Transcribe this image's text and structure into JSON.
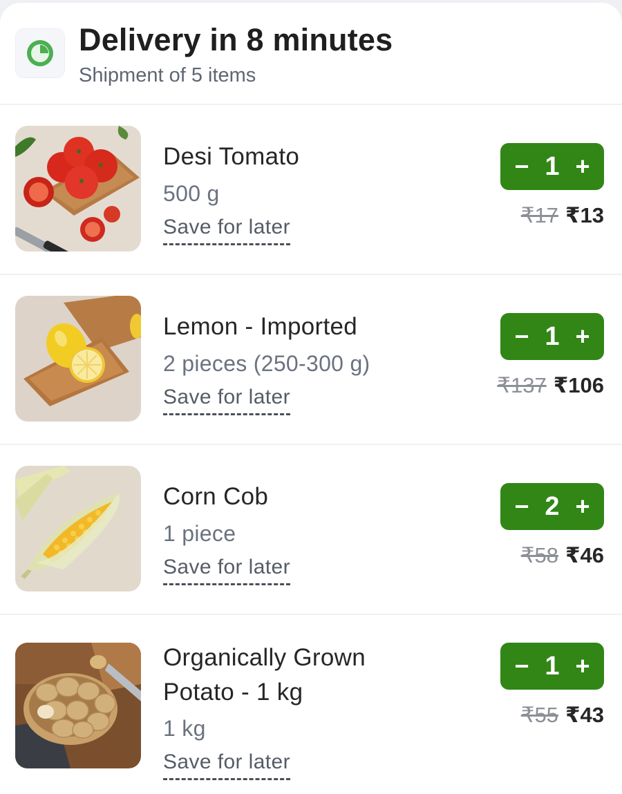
{
  "header": {
    "title": "Delivery in 8 minutes",
    "subtitle": "Shipment of 5 items",
    "icon": "clock-icon"
  },
  "colors": {
    "accent_green": "#318616",
    "icon_green": "#4caf50"
  },
  "items": [
    {
      "name_line1": "Desi Tomato",
      "name_line2": "",
      "quantity_text": "500 g",
      "save_label": "Save for later",
      "count": "1",
      "decrement": "−",
      "increment": "+",
      "mrp": "₹17",
      "price": "₹13",
      "image": "tomato-image"
    },
    {
      "name_line1": "Lemon - Imported",
      "name_line2": "",
      "quantity_text": "2 pieces (250-300 g)",
      "save_label": "Save for later",
      "count": "1",
      "decrement": "−",
      "increment": "+",
      "mrp": "₹137",
      "price": "₹106",
      "image": "lemon-image"
    },
    {
      "name_line1": "Corn Cob",
      "name_line2": "",
      "quantity_text": "1 piece",
      "save_label": "Save for later",
      "count": "2",
      "decrement": "−",
      "increment": "+",
      "mrp": "₹58",
      "price": "₹46",
      "image": "corn-image"
    },
    {
      "name_line1": "Organically Grown",
      "name_line2": "Potato - 1 kg",
      "quantity_text": "1 kg",
      "save_label": "Save for later",
      "count": "1",
      "decrement": "−",
      "increment": "+",
      "mrp": "₹55",
      "price": "₹43",
      "image": "potato-image"
    }
  ]
}
